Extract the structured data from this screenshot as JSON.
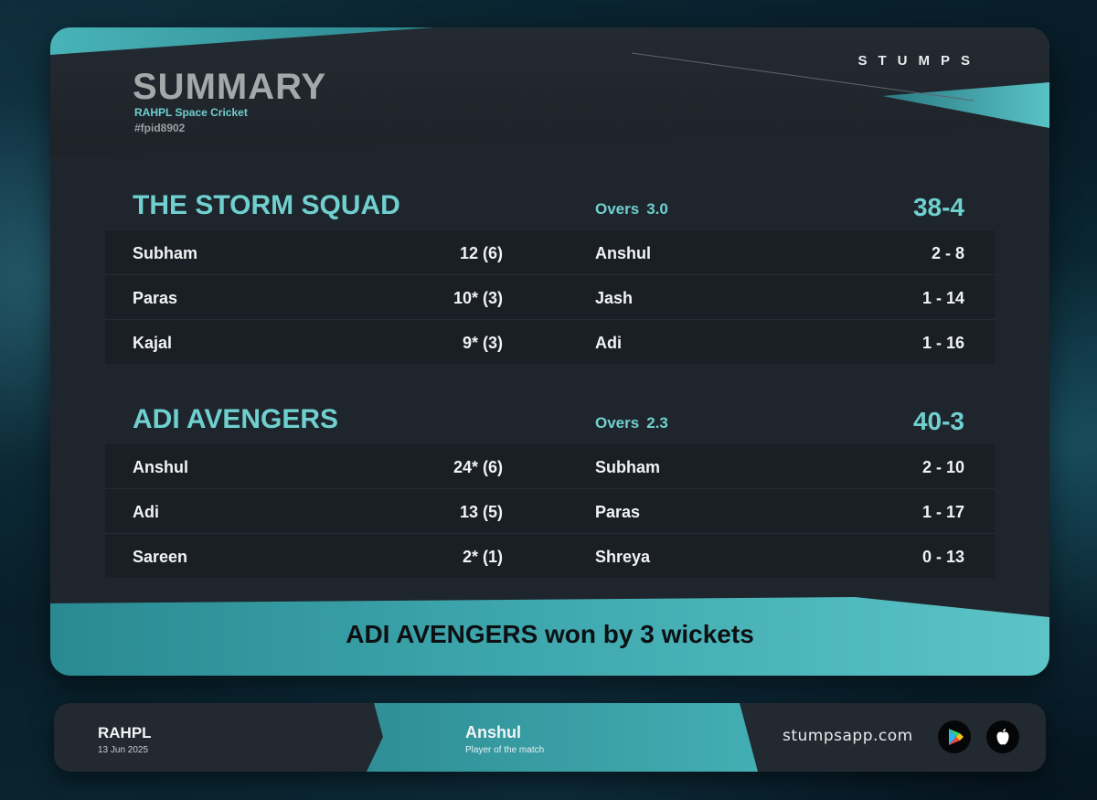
{
  "header": {
    "title": "SUMMARY",
    "subtitle": "RAHPL Space Cricket",
    "match_id": "#fpid8902",
    "brand": "STUMPS"
  },
  "innings": [
    {
      "team": "THE STORM SQUAD",
      "overs_label": "Overs",
      "overs": "3.0",
      "total": "38-4",
      "rows": [
        {
          "batter": "Subham",
          "bat_score": "12 (6)",
          "bowler": "Anshul",
          "bowl_figures": "2 - 8"
        },
        {
          "batter": "Paras",
          "bat_score": "10* (3)",
          "bowler": "Jash",
          "bowl_figures": "1 - 14"
        },
        {
          "batter": "Kajal",
          "bat_score": "9* (3)",
          "bowler": "Adi",
          "bowl_figures": "1 - 16"
        }
      ]
    },
    {
      "team": "ADI AVENGERS",
      "overs_label": "Overs",
      "overs": "2.3",
      "total": "40-3",
      "rows": [
        {
          "batter": "Anshul",
          "bat_score": "24* (6)",
          "bowler": "Subham",
          "bowl_figures": "2 - 10"
        },
        {
          "batter": "Adi",
          "bat_score": "13 (5)",
          "bowler": "Paras",
          "bowl_figures": "1 - 17"
        },
        {
          "batter": "Sareen",
          "bat_score": "2* (1)",
          "bowler": "Shreya",
          "bowl_figures": "0 - 13"
        }
      ]
    }
  ],
  "result": "ADI AVENGERS won by 3 wickets",
  "footer": {
    "league": "RAHPL",
    "date": "13 Jun 2025",
    "player_of_match": "Anshul",
    "player_of_match_label": "Player of the match",
    "website": "stumpsapp.com",
    "icons": [
      "google-play-icon",
      "apple-icon"
    ]
  },
  "colors": {
    "accent": "#6fd0cf",
    "teal_band": "#3aa5ab",
    "card_bg": "#1f252c",
    "row_bg": "#1a1f25"
  }
}
